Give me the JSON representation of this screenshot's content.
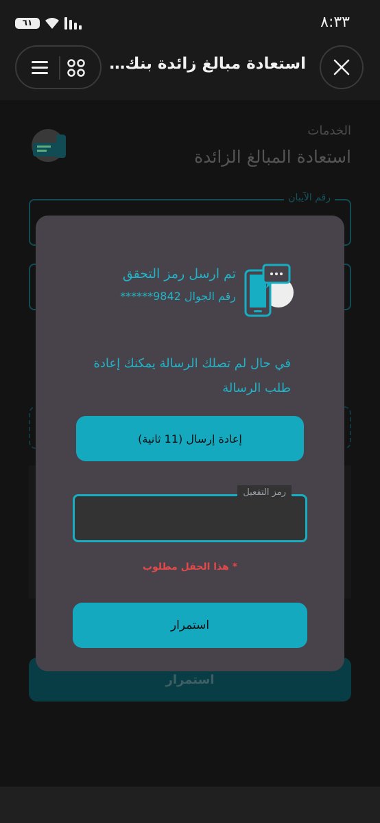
{
  "status_bar": {
    "time": "٨:٣٣",
    "battery_level": "٦١"
  },
  "header": {
    "title": "استعادة مبالغ زائدة بنك الراجحي"
  },
  "page": {
    "breadcrumb": "الخدمات",
    "title": "استعادة المبالغ الزائدة",
    "iban_label": "رقم الآيبان",
    "continue_label": "استمرار"
  },
  "modal": {
    "sent_title": "تم ارسل رمز التحقق",
    "sent_phone": "رقم الجوال 9842******",
    "hint": "في حال لم تصلك الرسالة يمكنك إعادة طلب الرسالة",
    "resend_label": "إعادة إرسال (11 ثانية)",
    "code_label": "رمز التفعيل",
    "code_value": "",
    "error": "* هذا الحقل مطلوب",
    "continue_label": "استمرار"
  },
  "colors": {
    "accent": "#14a9bf",
    "modal_bg": "#48434a",
    "error": "#e2494a",
    "background": "#1b1b1b"
  }
}
